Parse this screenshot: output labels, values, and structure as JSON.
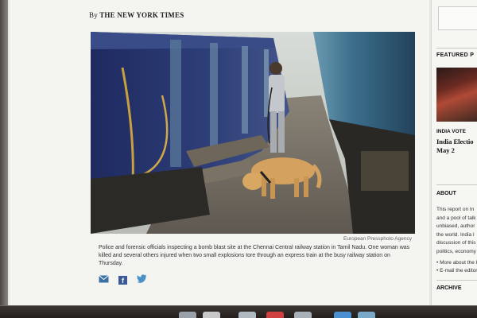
{
  "article": {
    "byline_prefix": "By",
    "byline_source": "THE NEW YORK TIMES",
    "photo_credit": "European Pressphoto Agency",
    "caption": "Police and forensic officials inspecting a bomb blast site at the Chennai Central railway station in Tamil Nadu. One woman was killed and several others injured when two small explosions tore through an express train at the busy railway station on Thursday."
  },
  "share": {
    "icons": [
      "email-icon",
      "facebook-icon",
      "twitter-icon"
    ],
    "facebook_glyph": "f"
  },
  "sidebar": {
    "featured_title": "FEATURED P",
    "section_label": "INDIA VOTE",
    "headline_line1": "India Electio",
    "headline_line2": "May 2",
    "about_title": "ABOUT",
    "about_text": "This report on In\nand a pool of talk\nunbiased, author\nthe world. India I\ndiscussion of this\npolitics, economy",
    "links": "• More about the I\n• E-mail the editor",
    "archive_title": "ARCHIVE"
  },
  "colors": {
    "twitter": "#4a90c8",
    "facebook": "#3b5998",
    "email": "#3a6fa5",
    "train": "#2e3e78",
    "train_right": "#3b6e8c",
    "dog": "#d4a25e"
  }
}
